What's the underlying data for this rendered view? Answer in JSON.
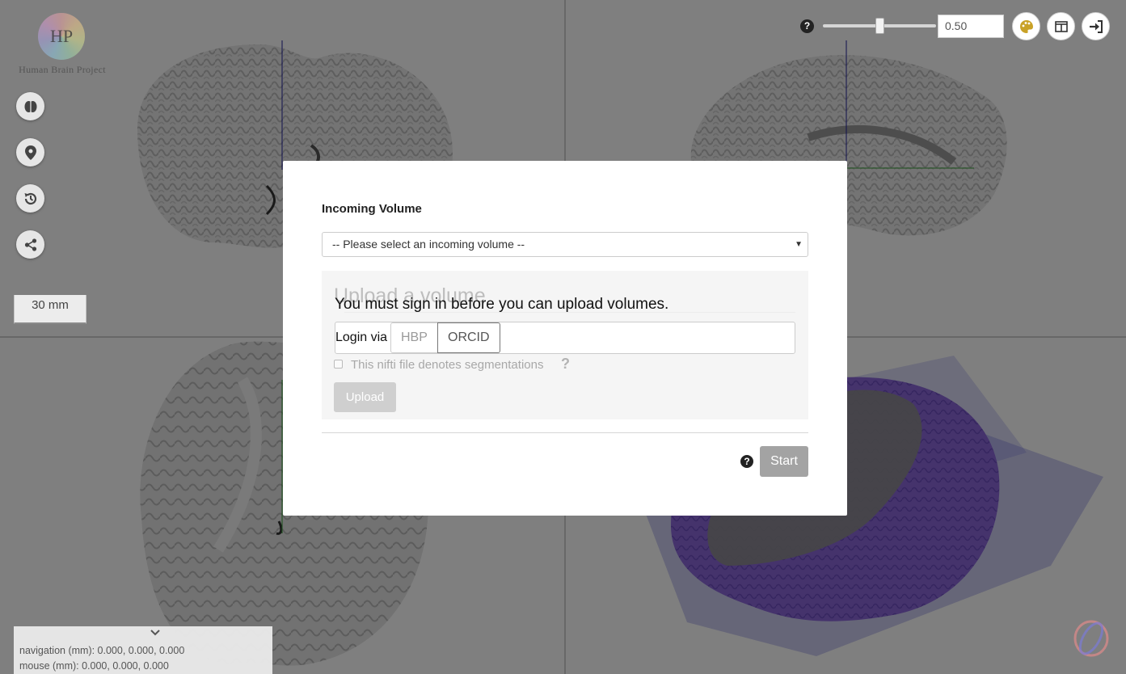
{
  "header": {
    "logo_text": "Human Brain Project",
    "logo_monogram": "HP",
    "opacity_value": "0.50"
  },
  "sidebar": {
    "buttons": [
      {
        "name": "brain-icon"
      },
      {
        "name": "map-marker-icon"
      },
      {
        "name": "history-icon"
      },
      {
        "name": "share-icon"
      }
    ]
  },
  "viewer": {
    "scale_bar": "30 mm",
    "navigation": "navigation (mm): 0.000, 0.000, 0.000",
    "mouse": "mouse (mm): 0.000, 0.000, 0.000"
  },
  "toolbar": {
    "icons": [
      "help-icon",
      "palette-icon",
      "layout-icon",
      "sign-in-icon"
    ]
  },
  "modal": {
    "incoming_label": "Incoming Volume",
    "select_placeholder": "-- Please select an incoming volume --",
    "upload_heading": "Upload a volume",
    "signin_message": "You must sign in before you can upload volumes.",
    "login_via": "Login via",
    "login_options": [
      "HBP",
      "ORCID"
    ],
    "segmentation_label": "This nifti file denotes segmentations",
    "segmentation_help": "?",
    "upload_button": "Upload",
    "start_button": "Start",
    "help_symbol": "?"
  },
  "colors": {
    "overlay": "#808080",
    "brain_surface": "#8a66d9",
    "start_button": "#a3a3a3"
  }
}
